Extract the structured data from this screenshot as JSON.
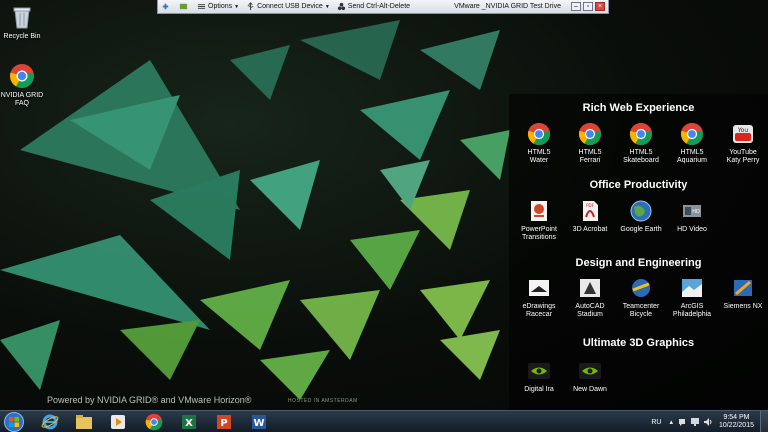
{
  "toolbar": {
    "options_label": "Options",
    "usb_label": "Connect USB Device",
    "cad_label": "Send Ctrl-Alt-Delete",
    "title": "VMware _NVIDIA GRID Test Drive"
  },
  "desktop_icons": {
    "recycle_bin": "Recycle Bin",
    "faq_line1": "NVIDIA GRID",
    "faq_line2": "FAQ"
  },
  "panel": {
    "sections": [
      {
        "title": "Rich Web Experience",
        "apps": [
          {
            "line1": "HTML5",
            "line2": "Water"
          },
          {
            "line1": "HTML5",
            "line2": "Ferrari"
          },
          {
            "line1": "HTML5",
            "line2": "Skateboard"
          },
          {
            "line1": "HTML5",
            "line2": "Aquarium"
          },
          {
            "line1": "YouTube",
            "line2": "Katy Perry"
          }
        ]
      },
      {
        "title": "Office Productivity",
        "apps": [
          {
            "line1": "PowerPoint",
            "line2": "Transitions"
          },
          {
            "line1": "3D Acrobat",
            "line2": ""
          },
          {
            "line1": "Google Earth",
            "line2": ""
          },
          {
            "line1": "HD Video",
            "line2": ""
          }
        ]
      },
      {
        "title": "Design and Engineering",
        "apps": [
          {
            "line1": "eDrawings",
            "line2": "Racecar"
          },
          {
            "line1": "AutoCAD",
            "line2": "Stadium"
          },
          {
            "line1": "Teamcenter",
            "line2": "Bicycle"
          },
          {
            "line1": "ArcGIS",
            "line2": "Philadelphia"
          },
          {
            "line1": "Siemens NX",
            "line2": ""
          }
        ]
      },
      {
        "title": "Ultimate 3D Graphics",
        "apps": [
          {
            "line1": "Digital Ira",
            "line2": ""
          },
          {
            "line1": "New Dawn",
            "line2": ""
          }
        ]
      }
    ]
  },
  "branding": {
    "powered": "Powered by NVIDIA GRID® and VMware Horizon®",
    "hosted": "HOSTED IN AMSTERDAM"
  },
  "taskbar": {
    "language": "RU",
    "time": "9:54 PM",
    "date": "10/22/2015"
  },
  "colors": {
    "accent_green": "#76b900",
    "taskbar": "#1b2734"
  }
}
